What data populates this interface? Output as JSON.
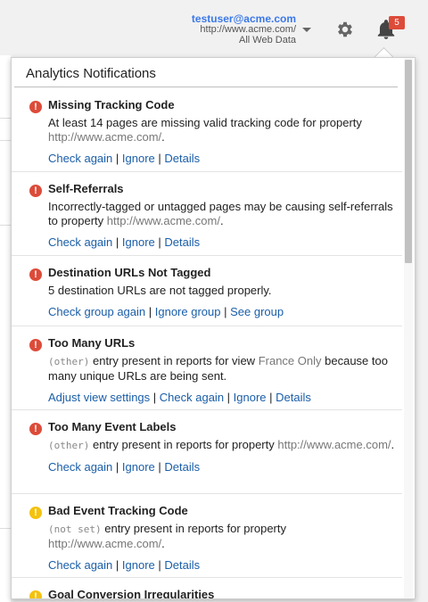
{
  "header": {
    "email": "testuser@acme.com",
    "property_url": "http://www.acme.com/",
    "view": "All Web Data",
    "notification_count": "5"
  },
  "panel": {
    "title": "Analytics Notifications",
    "sep": " | ",
    "items": [
      {
        "severity": "error",
        "title": "Missing Tracking Code",
        "desc_text": "At least 14 pages are missing valid tracking code for property",
        "desc_gray": "http://www.acme.com/",
        "desc_end": ".",
        "actions": [
          "Check again",
          "Ignore",
          "Details"
        ]
      },
      {
        "severity": "error",
        "title": "Self-Referrals",
        "desc_text": "Incorrectly-tagged or untagged pages may be causing self-referrals to property",
        "desc_gray": "http://www.acme.com/",
        "desc_end": ".",
        "actions": [
          "Check again",
          "Ignore",
          "Details"
        ]
      },
      {
        "severity": "error",
        "title": "Destination URLs Not Tagged",
        "desc_text": "5 destination URLs are not tagged properly.",
        "actions": [
          "Check group again",
          "Ignore group",
          "See group"
        ]
      },
      {
        "severity": "error",
        "title": "Too Many URLs",
        "desc_code": "(other)",
        "desc_text": "entry present in reports for view",
        "desc_gray": "France Only",
        "desc_tail": "because too many unique URLs are being sent.",
        "actions": [
          "Adjust view settings",
          "Check again",
          "Ignore",
          "Details"
        ]
      },
      {
        "severity": "error",
        "title": "Too Many Event Labels",
        "desc_code": "(other)",
        "desc_text": "entry present in reports for property",
        "desc_gray": "http://www.acme.com/",
        "desc_end": ".",
        "actions": [
          "Check again",
          "Ignore",
          "Details"
        ]
      },
      {
        "severity": "warning",
        "title": "Bad Event Tracking Code",
        "desc_code": "(not set)",
        "desc_text": "entry present in reports for property",
        "desc_gray": "http://www.acme.com/",
        "desc_end": ".",
        "actions": [
          "Check again",
          "Ignore",
          "Details"
        ]
      },
      {
        "severity": "warning",
        "title": "Goal Conversion Irregularities"
      }
    ]
  }
}
